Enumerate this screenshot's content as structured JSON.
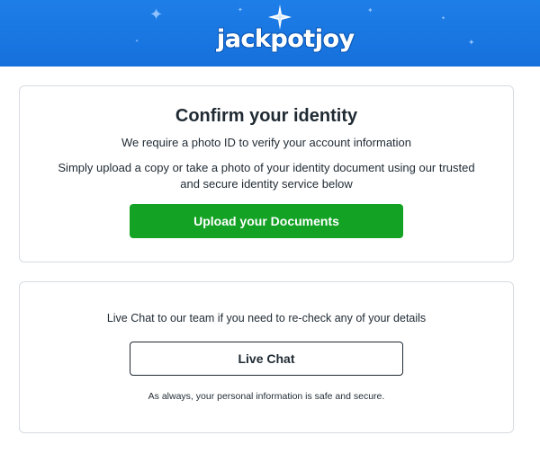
{
  "header": {
    "logo_text": "jackpotjoy",
    "background_color": "#1a76e2"
  },
  "identity_card": {
    "title": "Confirm your identity",
    "subtitle": "We require a photo ID to verify your account information",
    "description": "Simply upload a copy or take a photo of your identity document using our trusted and secure identity service below",
    "upload_button_label": "Upload your Documents",
    "upload_button_color": "#13a224"
  },
  "chat_card": {
    "prompt": "Live Chat to our team if you need to re-check any of your details",
    "live_chat_button_label": "Live Chat",
    "safety_note": "As always, your personal information is safe and secure."
  }
}
